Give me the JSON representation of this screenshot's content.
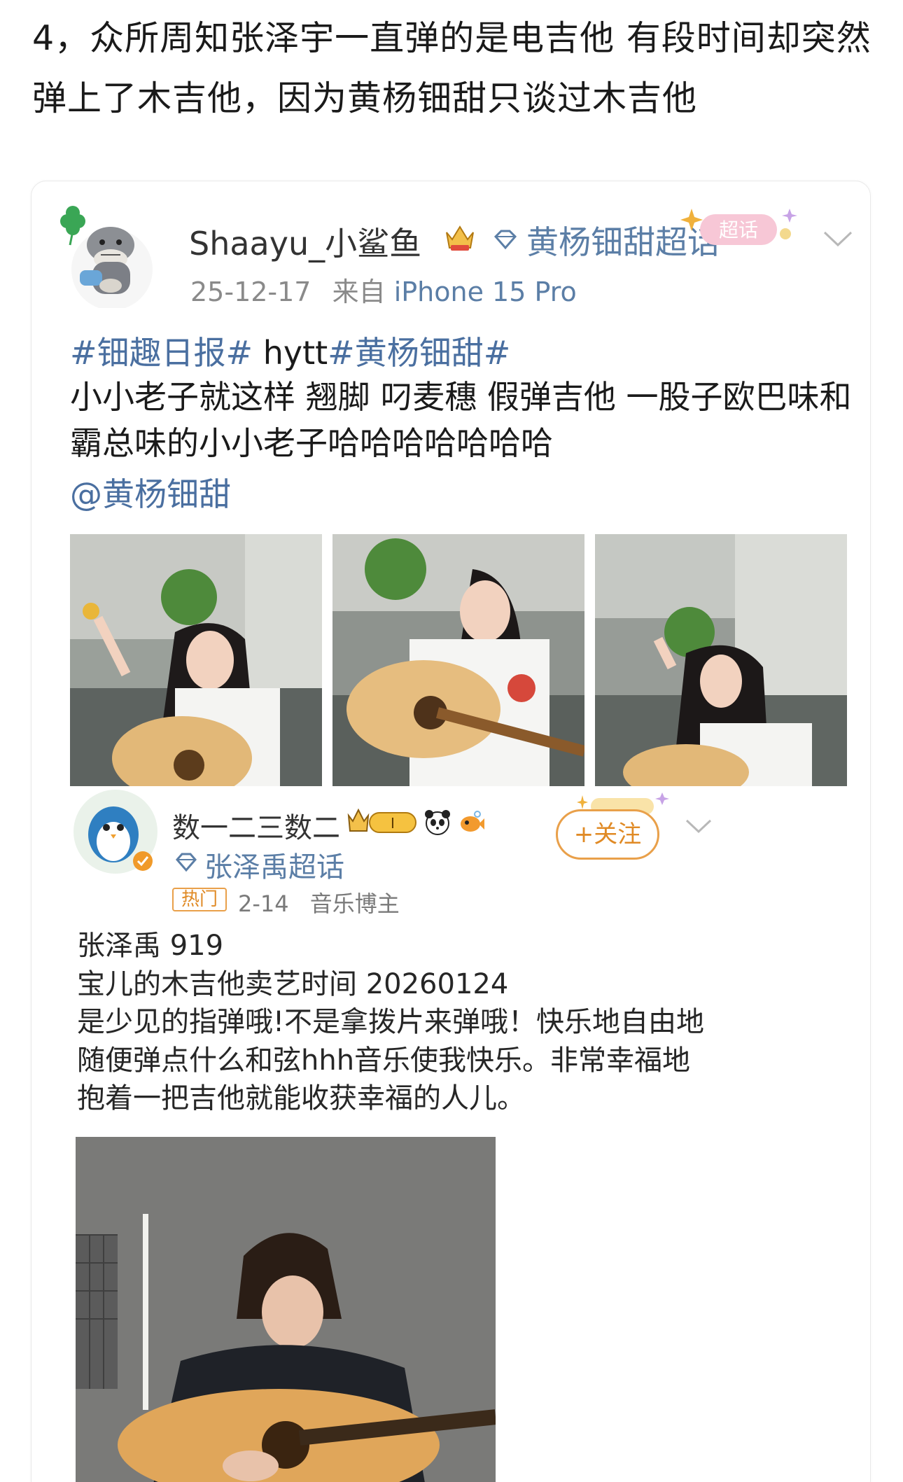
{
  "heading": "4，众所周知张泽宇一直弹的是电吉他 有段时间却突然弹上了木吉他，因为黄杨钿甜只谈过木吉他",
  "post1": {
    "author": "Shaayu_小鲨鱼",
    "topic": "黄杨钿甜超话",
    "super_badge": "超话",
    "date": "25-12-17",
    "source_prefix": "来自",
    "device": "iPhone 15 Pro",
    "hashtag1": "#钿趣日报#",
    "plain_tag": " hytt",
    "hashtag2": "#黄杨钿甜#",
    "body": "小小老子就这样 翘脚 叼麦穗 假弹吉他 一股子欧巴味和霸总味的小小老子哈哈哈哈哈哈哈",
    "mention": "@黄杨钿甜"
  },
  "post2": {
    "author": "数一二三数二",
    "level_badge": "I",
    "topic": "张泽禹超话",
    "follow_label": "+关注",
    "hot_tag": "热门",
    "date": "2-14",
    "role": "音乐博主",
    "body": "张泽禹 919\n宝儿的木吉他卖艺时间    20260124\n是少见的指弹哦!不是拿拨片来弹哦！快乐地自由地\n随便弹点什么和弦hhh音乐使我快乐。非常幸福地\n抱着一把吉他就能收获幸福的人儿。"
  },
  "colors": {
    "link_blue": "#4a6fa0",
    "topic_blue": "#5b7ea6",
    "follow_orange": "#e08a25",
    "meta_gray": "#8a8a8a"
  },
  "icons": [
    "clover-icon",
    "shark-plush-icon",
    "crown-badge-icon",
    "diamond-icon",
    "super-topic-badge-icon",
    "chevron-down-icon",
    "penguin-avatar-icon",
    "verified-icon",
    "level-crown-badge-icon",
    "panda-icon",
    "fish-icon"
  ]
}
